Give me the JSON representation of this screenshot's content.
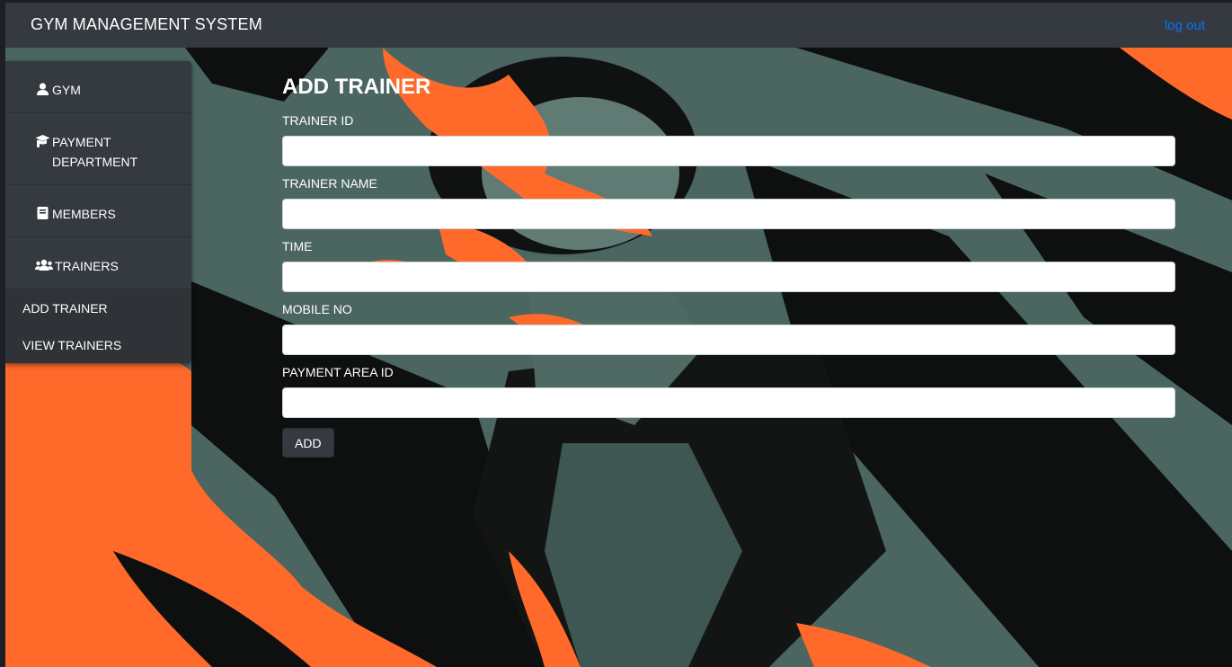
{
  "navbar": {
    "brand": "GYM MANAGEMENT SYSTEM",
    "logout_label": "log out",
    "logout_color": "#0d6efd"
  },
  "sidebar": {
    "items": [
      {
        "label": "GYM",
        "icon": "user-icon"
      },
      {
        "label": "PAYMENT DEPARTMENT",
        "icon": "graduation-cap-icon"
      },
      {
        "label": "MEMBERS",
        "icon": "book-icon"
      },
      {
        "label": "TRAINERS",
        "icon": "users-icon"
      }
    ],
    "submenu": [
      {
        "label": "ADD TRAINER"
      },
      {
        "label": "VIEW TRAINERS"
      }
    ]
  },
  "form": {
    "title": "ADD TRAINER",
    "fields": [
      {
        "label": "TRAINER ID",
        "value": ""
      },
      {
        "label": "TRAINER NAME",
        "value": ""
      },
      {
        "label": "TIME",
        "value": ""
      },
      {
        "label": "MOBILE NO",
        "value": ""
      },
      {
        "label": "PAYMENT AREA ID",
        "value": ""
      }
    ],
    "submit_label": "ADD"
  },
  "colors": {
    "navbar_bg": "#343a40",
    "accent_orange": "#ff6a2b",
    "background_teal": "#4b6660"
  }
}
